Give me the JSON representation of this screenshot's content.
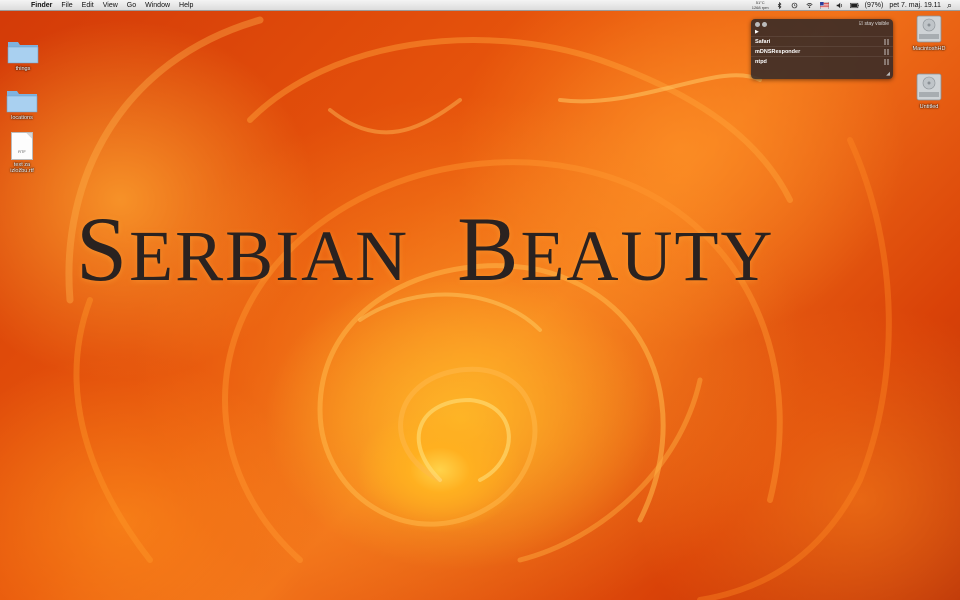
{
  "menubar": {
    "apple_glyph": "",
    "app_name": "Finder",
    "menus": [
      "File",
      "Edit",
      "View",
      "Go",
      "Window",
      "Help"
    ],
    "temperature": "51°C",
    "fan_speed": "1268 rpm",
    "battery": "(97%)",
    "clock": "pet 7. maj. 19.11",
    "search_glyph": "⌕"
  },
  "desktop_icons_left": [
    {
      "label": "things",
      "kind": "folder-icon"
    },
    {
      "label": "locations",
      "kind": "folder-icon"
    },
    {
      "label": "text za izložbu.rtf",
      "kind": "rtf-document-icon",
      "badge": "RTF"
    }
  ],
  "desktop_icons_right": [
    {
      "label": "MacintoshHD",
      "kind": "hard-drive-icon"
    },
    {
      "label": "Untitled",
      "kind": "hard-drive-icon"
    }
  ],
  "wallpaper": {
    "title_line": "Serbian Beauty",
    "part1_cap": "S",
    "part1_rest": "ERBIAN",
    "part2_cap": "B",
    "part2_rest": "EAUTY"
  },
  "widget": {
    "stay_visible_label": "stay visible",
    "stay_visible_checked": "☑",
    "arrow": "▶",
    "rows": [
      "Safari",
      "mDNSResponder",
      "ntpd"
    ]
  },
  "colors": {
    "rose_dark": "#b52b06",
    "rose_mid": "#e8560c",
    "rose_light": "#ffd24a",
    "title_text": "#2a2220"
  }
}
